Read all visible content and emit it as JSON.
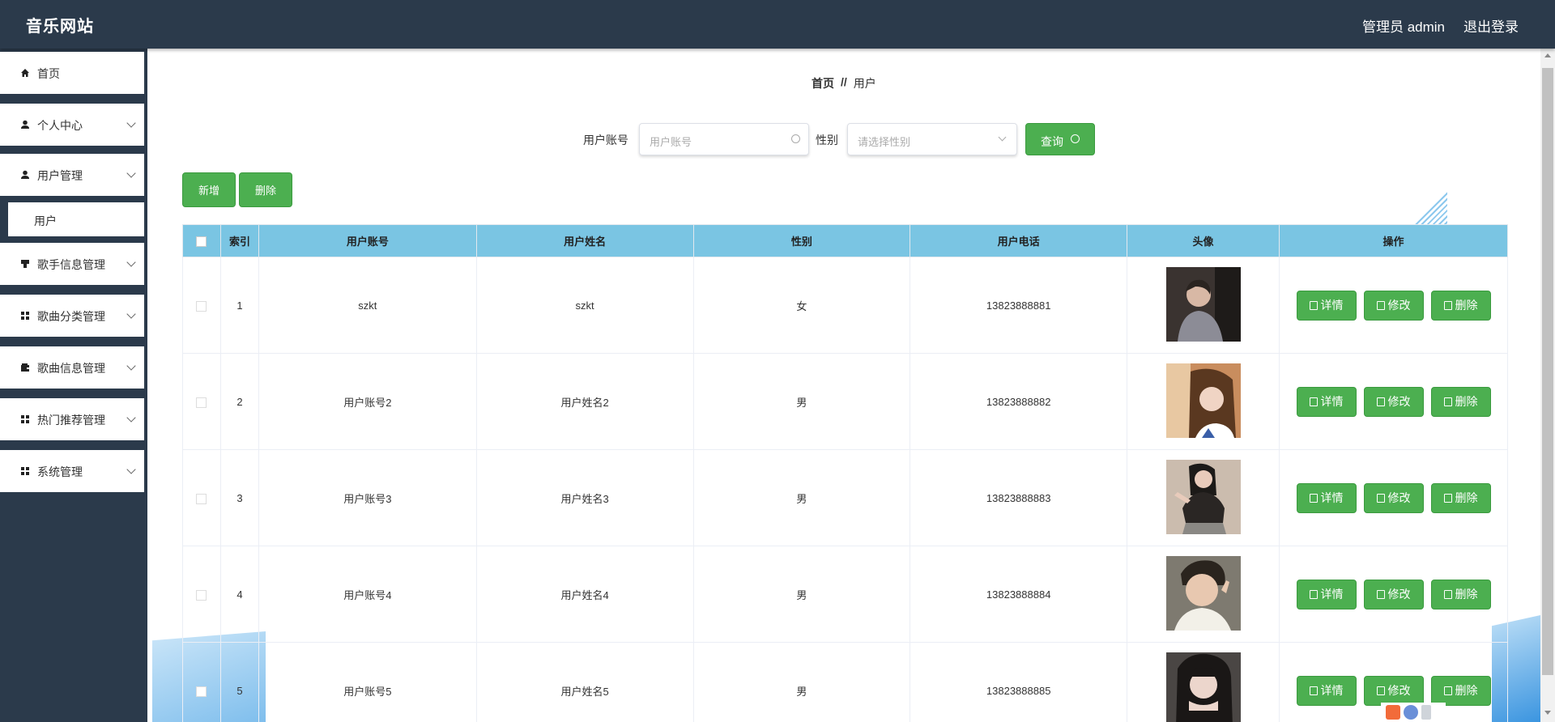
{
  "header": {
    "brand": "音乐网站",
    "admin_label": "管理员 admin",
    "logout_label": "退出登录"
  },
  "sidebar": {
    "items": [
      {
        "label": "首页",
        "icon": "home-icon"
      },
      {
        "label": "个人中心",
        "icon": "user-icon"
      },
      {
        "label": "用户管理",
        "icon": "user-icon"
      },
      {
        "label": "歌手信息管理",
        "icon": "mic-icon"
      },
      {
        "label": "歌曲分类管理",
        "icon": "grid-icon"
      },
      {
        "label": "歌曲信息管理",
        "icon": "wallet-icon"
      },
      {
        "label": "热门推荐管理",
        "icon": "grid-icon"
      },
      {
        "label": "系统管理",
        "icon": "grid-icon"
      }
    ],
    "submenu_user": "用户"
  },
  "breadcrumb": {
    "home": "首页",
    "sep": "//",
    "current": "用户"
  },
  "search": {
    "account_label": "用户账号",
    "account_placeholder": "用户账号",
    "gender_label": "性别",
    "gender_placeholder": "请选择性别",
    "query_label": "查询"
  },
  "actions": {
    "add_label": "新增",
    "delete_label": "删除"
  },
  "table": {
    "columns": [
      "索引",
      "用户账号",
      "用户姓名",
      "性别",
      "用户电话",
      "头像",
      "操作"
    ],
    "rows": [
      {
        "index": "1",
        "account": "szkt",
        "name": "szkt",
        "gender": "女",
        "phone": "13823888881"
      },
      {
        "index": "2",
        "account": "用户账号2",
        "name": "用户姓名2",
        "gender": "男",
        "phone": "13823888882"
      },
      {
        "index": "3",
        "account": "用户账号3",
        "name": "用户姓名3",
        "gender": "男",
        "phone": "13823888883"
      },
      {
        "index": "4",
        "account": "用户账号4",
        "name": "用户姓名4",
        "gender": "男",
        "phone": "13823888884"
      },
      {
        "index": "5",
        "account": "用户账号5",
        "name": "用户姓名5",
        "gender": "男",
        "phone": "13823888885"
      }
    ],
    "op_labels": {
      "detail": "详情",
      "edit": "修改",
      "delete": "删除"
    }
  },
  "colors": {
    "header_bg": "#2b3a4b",
    "accent_green": "#4caf50",
    "table_header": "#7ac5e3"
  }
}
